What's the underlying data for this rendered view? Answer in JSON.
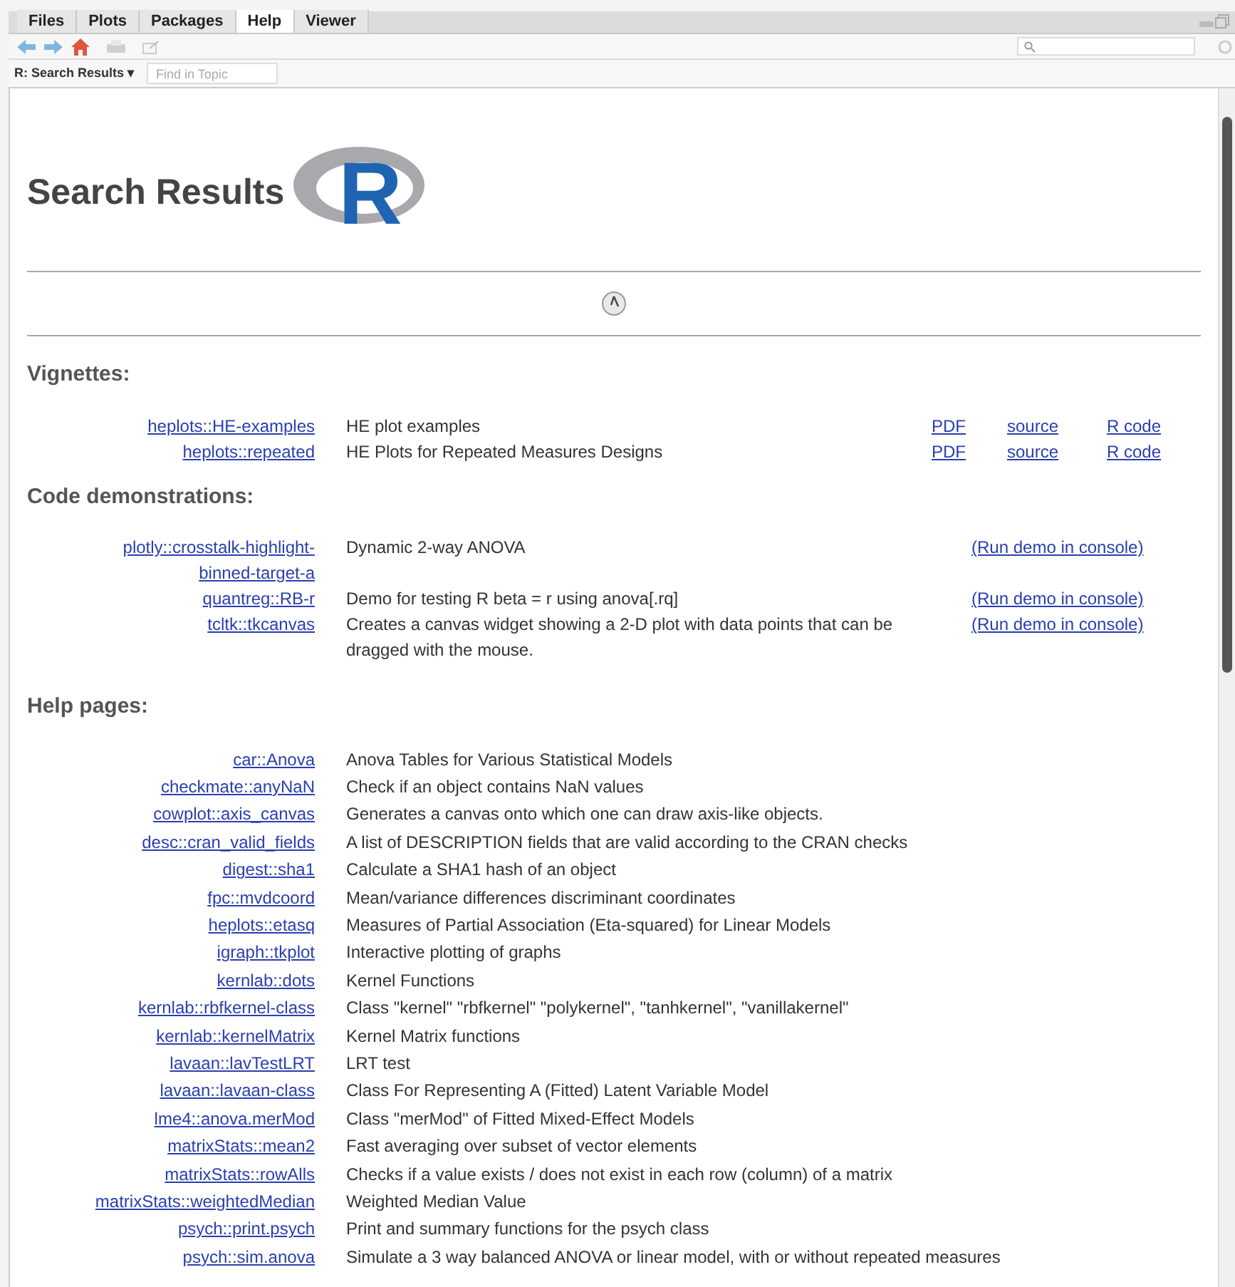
{
  "tabs": [
    {
      "label": "Files",
      "selected": false
    },
    {
      "label": "Plots",
      "selected": false
    },
    {
      "label": "Packages",
      "selected": false
    },
    {
      "label": "Help",
      "selected": true
    },
    {
      "label": "Viewer",
      "selected": false
    }
  ],
  "topic_menu": {
    "label": "R: Search Results",
    "caret": "▾"
  },
  "find_in_topic": {
    "placeholder": "Find in Topic"
  },
  "page": {
    "title": "Search Results",
    "logo_letter": "R"
  },
  "vignettes": {
    "heading": "Vignettes:",
    "rows": [
      {
        "topic": "heplots::HE-examples",
        "description": "HE plot examples",
        "links": [
          "PDF",
          "source",
          "R code"
        ]
      },
      {
        "topic": "heplots::repeated",
        "description": "HE Plots for Repeated Measures Designs",
        "links": [
          "PDF",
          "source",
          "R code"
        ]
      }
    ]
  },
  "demos": {
    "heading": "Code demonstrations:",
    "rows": [
      {
        "topic": "plotly::crosstalk-highlight-binned-target-a",
        "description": "Dynamic 2-way ANOVA",
        "action": "(Run demo in console)"
      },
      {
        "topic": "quantreg::RB-r",
        "description": "Demo for testing R beta = r using anova[.rq]",
        "action": "(Run demo in console)"
      },
      {
        "topic": "tcltk::tkcanvas",
        "description": "Creates a canvas widget showing a 2-D plot with data points that can be dragged with the mouse.",
        "action": "(Run demo in console)"
      }
    ]
  },
  "help_pages": {
    "heading": "Help pages:",
    "rows": [
      {
        "topic": "car::Anova",
        "description": "Anova Tables for Various Statistical Models"
      },
      {
        "topic": "checkmate::anyNaN",
        "description": "Check if an object contains NaN values"
      },
      {
        "topic": "cowplot::axis_canvas",
        "description": "Generates a canvas onto which one can draw axis-like objects."
      },
      {
        "topic": "desc::cran_valid_fields",
        "description": "A list of DESCRIPTION fields that are valid according to the CRAN checks"
      },
      {
        "topic": "digest::sha1",
        "description": "Calculate a SHA1 hash of an object"
      },
      {
        "topic": "fpc::mvdcoord",
        "description": "Mean/variance differences discriminant coordinates"
      },
      {
        "topic": "heplots::etasq",
        "description": "Measures of Partial Association (Eta-squared) for Linear Models"
      },
      {
        "topic": "igraph::tkplot",
        "description": "Interactive plotting of graphs"
      },
      {
        "topic": "kernlab::dots",
        "description": "Kernel Functions"
      },
      {
        "topic": "kernlab::rbfkernel-class",
        "description": "Class \"kernel\" \"rbfkernel\" \"polykernel\", \"tanhkernel\", \"vanillakernel\""
      },
      {
        "topic": "kernlab::kernelMatrix",
        "description": "Kernel Matrix functions"
      },
      {
        "topic": "lavaan::lavTestLRT",
        "description": "LRT test"
      },
      {
        "topic": "lavaan::lavaan-class",
        "description": "Class For Representing A (Fitted) Latent Variable Model"
      },
      {
        "topic": "lme4::anova.merMod",
        "description": "Class \"merMod\" of Fitted Mixed-Effect Models"
      },
      {
        "topic": "matrixStats::mean2",
        "description": "Fast averaging over subset of vector elements"
      },
      {
        "topic": "matrixStats::rowAlls",
        "description": "Checks if a value exists / does not exist in each row (column) of a matrix"
      },
      {
        "topic": "matrixStats::weightedMedian",
        "description": "Weighted Median Value"
      },
      {
        "topic": "psych::print.psych",
        "description": "Print and summary functions for the psych class"
      },
      {
        "topic": "psych::sim.anova",
        "description": "Simulate a 3 way balanced ANOVA or linear model, with or without repeated measures"
      }
    ]
  }
}
